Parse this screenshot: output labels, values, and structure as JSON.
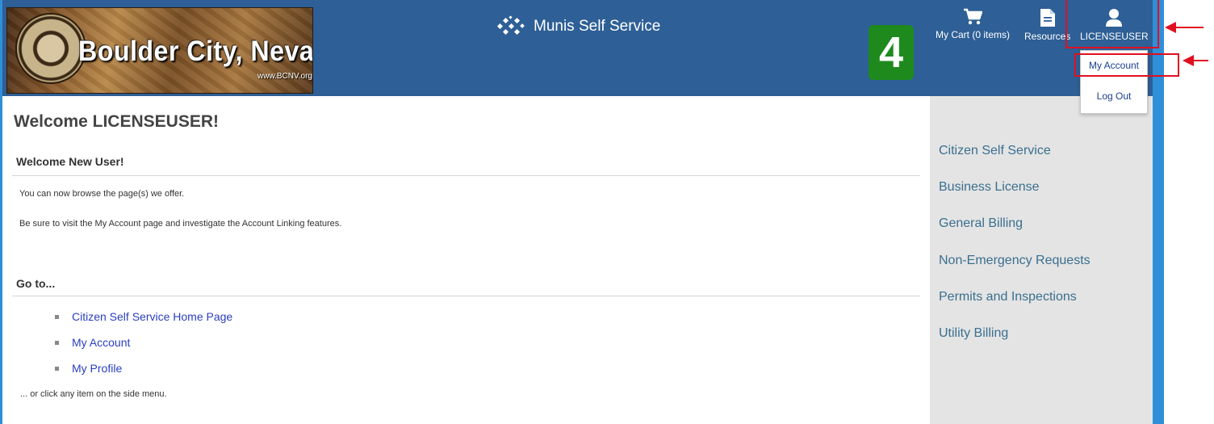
{
  "header": {
    "logo_title": "Boulder City, Nevada",
    "logo_url": "www.BCNV.org",
    "app_title": "Munis Self Service",
    "step_badge": "4",
    "cart_label": "My Cart (0 items)",
    "resources_label": "Resources",
    "user_label": "LICENSEUSER",
    "dropdown": {
      "my_account": "My Account",
      "log_out": "Log Out"
    }
  },
  "main": {
    "welcome": "Welcome LICENSEUSER!",
    "section1_title": "Welcome New User!",
    "p1": "You can now browse the page(s) we offer.",
    "p2": "Be sure to visit the My Account page and investigate the Account Linking features.",
    "section2_title": "Go to...",
    "links": [
      "Citizen Self Service Home Page",
      "My Account",
      "My Profile"
    ],
    "footer_note": "... or click any item on the side menu."
  },
  "sidebar": {
    "items": [
      "Citizen Self Service",
      "Business License",
      "General Billing",
      "Non-Emergency Requests",
      "Permits and Inspections",
      "Utility Billing"
    ]
  },
  "colors": {
    "header_bg": "#2e5f96",
    "annotation": "#e01020",
    "badge": "#1e8a1e"
  }
}
